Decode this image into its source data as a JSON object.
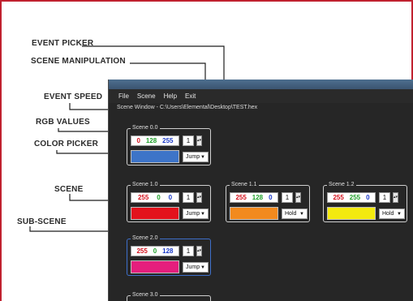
{
  "annotations": {
    "event_picker": "EVENT PICKER",
    "scene_manipulation": "SCENE MANIPULATION",
    "event_speed": "EVENT SPEED",
    "rgb_values": "RGB VALUES",
    "color_picker": "COLOR PICKER",
    "scene": "SCENE",
    "sub_scene": "SUB-SCENE"
  },
  "menu": {
    "file": "File",
    "scene": "Scene",
    "help": "Help",
    "exit": "Exit"
  },
  "path": "Scene Window - C:\\Users\\Elemental\\Desktop\\TEST.hex",
  "scenes": {
    "s00": {
      "label": "Scene 0.0",
      "r": "0",
      "g": "128",
      "b": "255",
      "speed": "1",
      "event": "Jump",
      "color": "#3d74c8"
    },
    "s10": {
      "label": "Scene 1.0",
      "r": "255",
      "g": "0",
      "b": "0",
      "speed": "1",
      "event": "Jump",
      "color": "#e3121c"
    },
    "s11": {
      "label": "Scene 1.1",
      "r": "255",
      "g": "128",
      "b": "0",
      "speed": "1",
      "event": "Hold",
      "color": "#f28a1e"
    },
    "s12": {
      "label": "Scene 1.2",
      "r": "255",
      "g": "255",
      "b": "0",
      "speed": "1",
      "event": "Hold",
      "color": "#f3ea0f"
    },
    "s20": {
      "label": "Scene 2.0",
      "r": "255",
      "g": "0",
      "b": "128",
      "speed": "1",
      "event": "Jump",
      "color": "#e51e7d"
    },
    "s30": {
      "label": "Scene 3.0"
    }
  },
  "icons": {
    "spin": "spin-arrows-icon",
    "caret": "caret-down-icon"
  },
  "colors": {
    "border_accent": "#c0212f",
    "window_bg": "#262626",
    "selection": "#3e6fc9"
  }
}
